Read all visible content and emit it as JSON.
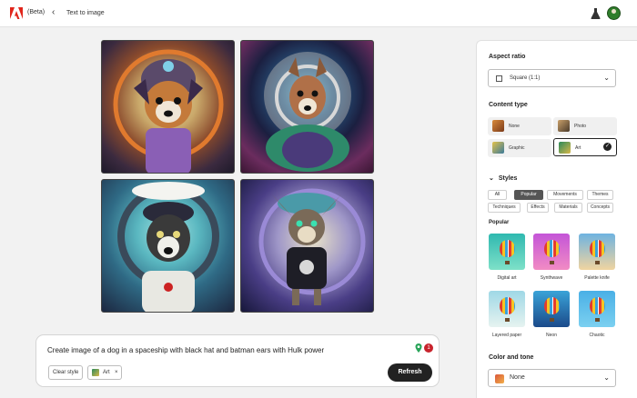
{
  "header": {
    "beta_label": "(Beta)",
    "back_glyph": "‹",
    "title": "Text to image",
    "brand_color": "#e1251b"
  },
  "gallery": {
    "images": [
      {
        "description": "dog in space helmet, orange ring"
      },
      {
        "description": "dog in space helmet, purple orb"
      },
      {
        "description": "dog in helmet with cap, teal ring"
      },
      {
        "description": "dog with cap, green eyes, purple ring"
      }
    ]
  },
  "prompt": {
    "text": "Create image of a dog in a spaceship with black hat and batman ears with Hulk power",
    "clear_style_label": "Clear style",
    "chip_label": "Art",
    "chip_close": "×",
    "refresh_label": "Refresh",
    "badge_text": "1"
  },
  "panel": {
    "aspect_ratio": {
      "title": "Aspect ratio",
      "value": "Square (1:1)",
      "chevron": "⌄"
    },
    "content_type": {
      "title": "Content type",
      "options": [
        {
          "label": "None",
          "selected": false
        },
        {
          "label": "Photo",
          "selected": false
        },
        {
          "label": "Graphic",
          "selected": false
        },
        {
          "label": "Art",
          "selected": true
        }
      ],
      "check": "✓"
    },
    "styles": {
      "title": "Styles",
      "toggle": "⌄",
      "filters": [
        "All",
        "Popular",
        "Movements",
        "Themes",
        "Techniques",
        "Effects",
        "Materials",
        "Concepts"
      ],
      "active_filter": "Popular",
      "popular_title": "Popular",
      "items": [
        {
          "label": "Digital art"
        },
        {
          "label": "Synthwave"
        },
        {
          "label": "Palette knife"
        },
        {
          "label": "Layered paper"
        },
        {
          "label": "Neon"
        },
        {
          "label": "Chaotic"
        }
      ]
    },
    "color_tone": {
      "title": "Color and tone",
      "value": "None",
      "chevron": "⌄"
    }
  }
}
